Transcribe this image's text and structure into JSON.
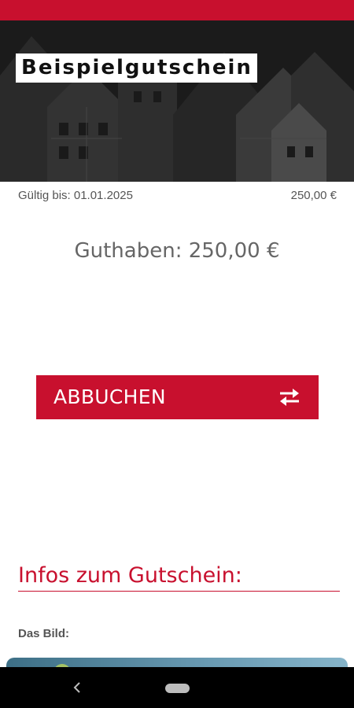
{
  "voucher": {
    "title": "Beispielgutschein",
    "valid_until": "Gültig bis: 01.01.2025",
    "amount": "250,00 €",
    "balance": "Guthaben: 250,00 €"
  },
  "actions": {
    "charge_label": "ABBUCHEN",
    "charge_icon": "swap-arrows-icon"
  },
  "info": {
    "heading": "Infos zum Gutschein:",
    "image_label": "Das Bild:"
  },
  "navigation": {
    "back_icon": "back-icon",
    "home_icon": "home-pill-icon"
  },
  "colors": {
    "brand": "#c8102e",
    "status_bar": "#c8102e",
    "nav_bar": "#000000"
  }
}
